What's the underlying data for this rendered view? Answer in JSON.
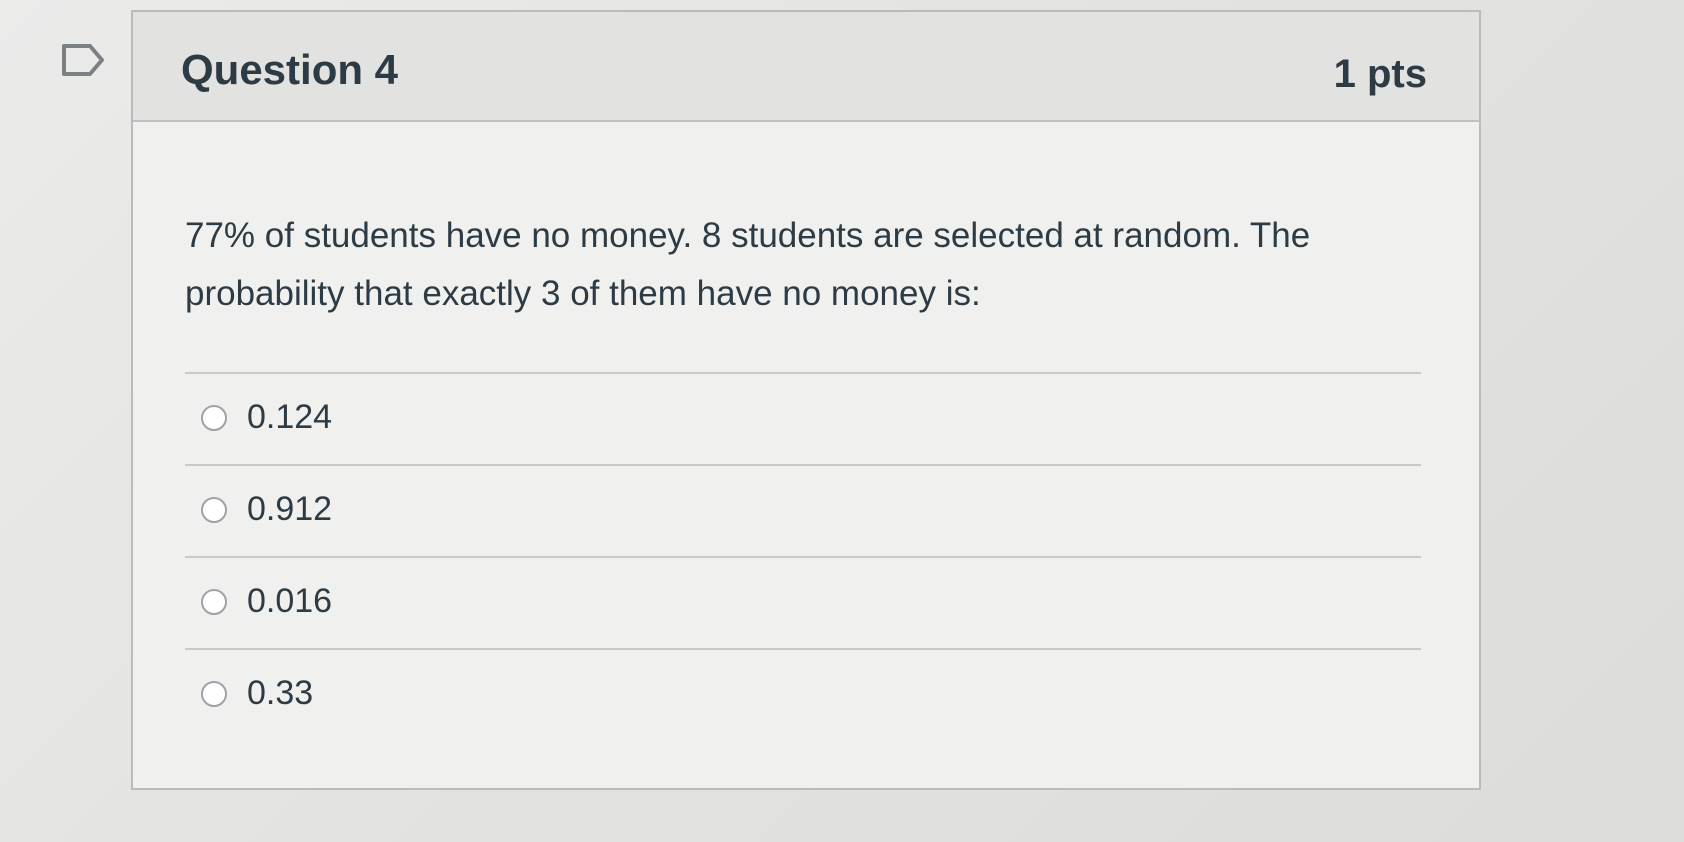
{
  "question": {
    "title": "Question 4",
    "points": "1 pts",
    "text": "77% of students have no money.  8 students are selected at random. The probability that exactly 3 of them have no money is:",
    "answers": [
      {
        "label": "0.124",
        "selected": false
      },
      {
        "label": "0.912",
        "selected": false
      },
      {
        "label": "0.016",
        "selected": false
      },
      {
        "label": "0.33",
        "selected": false
      }
    ]
  },
  "icons": {
    "flag": "flag-icon",
    "radio": "radio-button"
  },
  "colors": {
    "text": "#2d3b45",
    "header_background": "#e2e2e0",
    "card_background": "#f0f0ee",
    "border": "#b9bbbc"
  }
}
